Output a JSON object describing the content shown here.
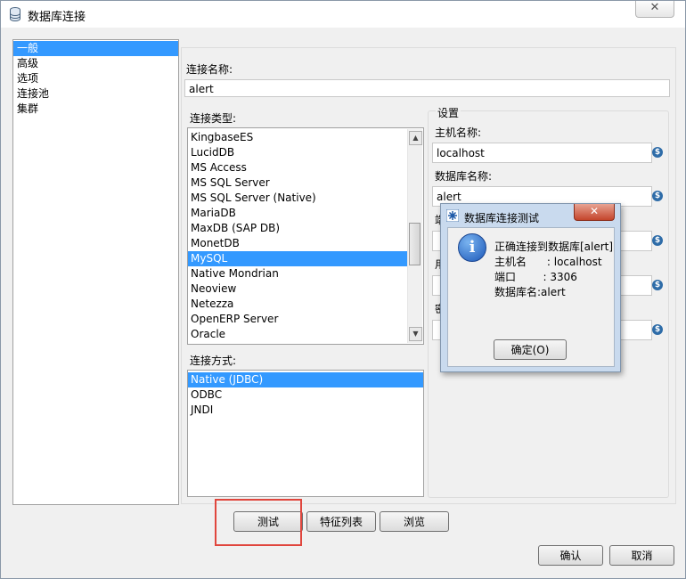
{
  "window": {
    "title": "数据库连接",
    "close_glyph": "✕"
  },
  "nav": {
    "items": [
      "一般",
      "高级",
      "选项",
      "连接池",
      "集群"
    ],
    "selected_index": 0
  },
  "general": {
    "conn_name_label": "连接名称:",
    "conn_name_value": "alert",
    "conn_type_label": "连接类型:",
    "conn_types": [
      "KingbaseES",
      "LucidDB",
      "MS Access",
      "MS SQL Server",
      "MS SQL Server (Native)",
      "MariaDB",
      "MaxDB (SAP DB)",
      "MonetDB",
      "MySQL",
      "Native Mondrian",
      "Neoview",
      "Netezza",
      "OpenERP Server",
      "Oracle"
    ],
    "conn_type_selected": "MySQL",
    "access_label": "连接方式:",
    "access_methods": [
      "Native (JDBC)",
      "ODBC",
      "JNDI"
    ],
    "access_selected": "Native (JDBC)"
  },
  "settings": {
    "group_label": "设置",
    "host_label": "主机名称:",
    "host_value": "localhost",
    "db_label": "数据库名称:",
    "db_value": "alert",
    "hidden_label_1": "端",
    "hidden_label_2": "用",
    "hidden_label_3": "密",
    "dollar_icon": "$"
  },
  "buttons": {
    "test": "测试",
    "features": "特征列表",
    "browse": "浏览",
    "ok": "确认",
    "cancel": "取消"
  },
  "dialog": {
    "title": "数据库连接测试",
    "close_glyph": "✕",
    "lines": [
      "正确连接到数据库[alert]",
      "主机名      : localhost",
      "端口        : 3306",
      "数据库名:alert"
    ],
    "ok_button": "确定(O)",
    "info_glyph": "i"
  },
  "colors": {
    "selection": "#3399ff",
    "highlight_box": "#e0463d"
  }
}
